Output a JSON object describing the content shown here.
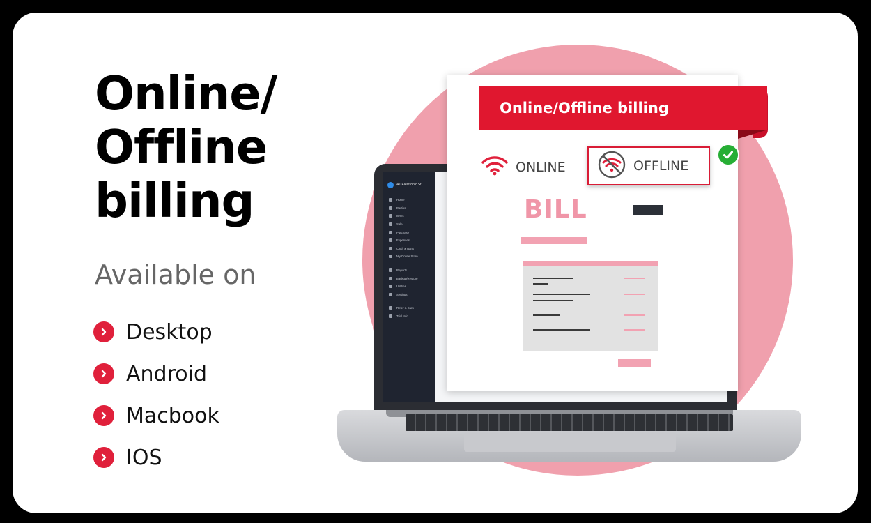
{
  "headline": "Online/\nOffline\nbilling",
  "available_label": "Available on",
  "platforms": [
    "Desktop",
    "Android",
    "Macbook",
    "IOS"
  ],
  "app": {
    "business_name": "A1 Electronic St.",
    "menu": [
      "Home",
      "Parties",
      "Items",
      "Sale",
      "Purchase",
      "Expenses",
      "Cash & Bank",
      "My Online Store",
      "Reports",
      "Backup/Restore",
      "Utilities",
      "Settings",
      "Refer & Earn",
      "Trial Info"
    ]
  },
  "ribbon_label": "Online/Offline billing",
  "online_label": "ONLINE",
  "offline_label": "OFFLINE",
  "bill_label": "BILL",
  "colors": {
    "accent": "#e0203b",
    "pink": "#f0a0ad",
    "check": "#27ae35"
  }
}
